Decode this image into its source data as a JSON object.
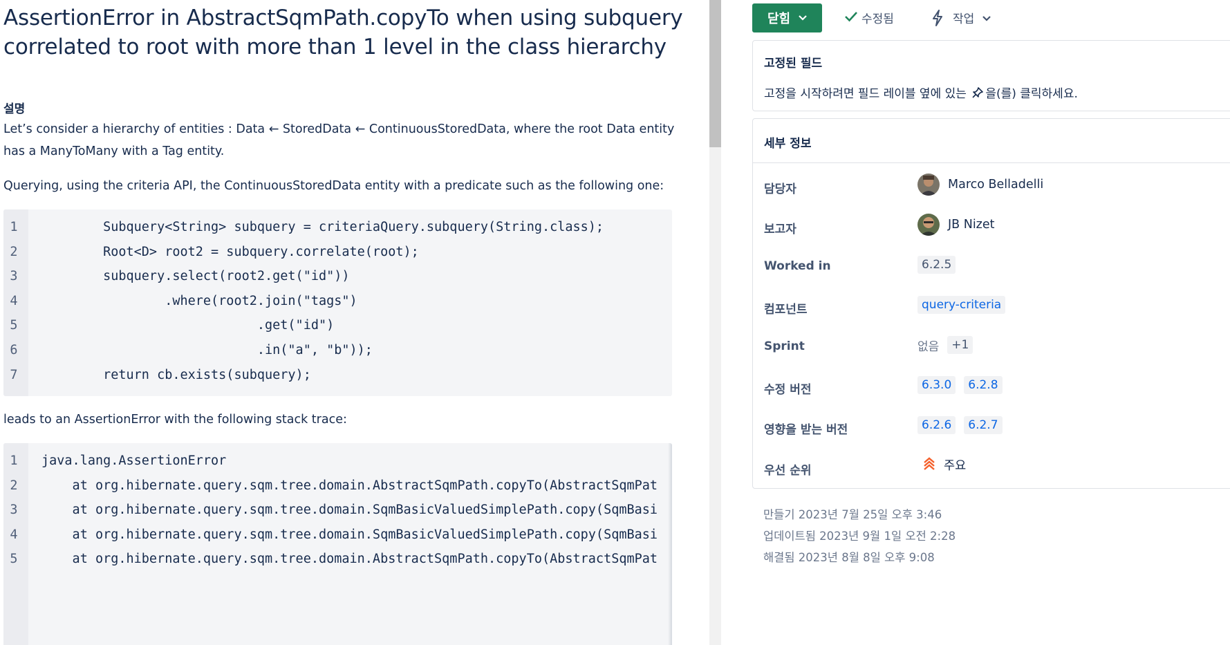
{
  "issue": {
    "title": "AssertionError in AbstractSqmPath.copyTo when using subquery correlated to root with more than 1 level in the class hierarchy",
    "description_heading": "설명",
    "paragraph1": "Let’s consider a hierarchy of entities : Data ← StoredData ← ContinuousStoredData, where the root Data entity has a ManyToMany with a Tag entity.",
    "paragraph2": "Querying, using the criteria API, the ContinuousStoredData entity with a predicate such as the following one:",
    "paragraph3": "leads to an AssertionError with the following stack trace:",
    "code1": [
      {
        "n": "1",
        "text": "        Subquery<String> subquery = criteriaQuery.subquery(String.class);"
      },
      {
        "n": "2",
        "text": "        Root<D> root2 = subquery.correlate(root);"
      },
      {
        "n": "3",
        "text": "        subquery.select(root2.get(\"id\"))"
      },
      {
        "n": "4",
        "text": "                .where(root2.join(\"tags\")"
      },
      {
        "n": "5",
        "text": "                            .get(\"id\")"
      },
      {
        "n": "6",
        "text": "                            .in(\"a\", \"b\"));"
      },
      {
        "n": "7",
        "text": "        return cb.exists(subquery);"
      }
    ],
    "code2": [
      {
        "n": "1",
        "text": "java.lang.AssertionError"
      },
      {
        "n": "2",
        "text": "    at org.hibernate.query.sqm.tree.domain.AbstractSqmPath.copyTo(AbstractSqmPat"
      },
      {
        "n": "3",
        "text": "    at org.hibernate.query.sqm.tree.domain.SqmBasicValuedSimplePath.copy(SqmBasi"
      },
      {
        "n": "4",
        "text": "    at org.hibernate.query.sqm.tree.domain.SqmBasicValuedSimplePath.copy(SqmBasi"
      },
      {
        "n": "5",
        "text": "    at org.hibernate.query.sqm.tree.domain.AbstractSqmPath.copyTo(AbstractSqmPat"
      }
    ]
  },
  "header": {
    "status_label": "닫힘",
    "resolution_label": "수정됨",
    "actions_label": "작업"
  },
  "pinned": {
    "title": "고정된 필드",
    "hint_before": "고정을 시작하려면 필드 레이블 옆에 있는",
    "hint_after": "을(를) 클릭하세요."
  },
  "details": {
    "title": "세부 정보",
    "assignee_label": "담당자",
    "assignee": "Marco Belladelli",
    "reporter_label": "보고자",
    "reporter": "JB Nizet",
    "worked_in_label": "Worked in",
    "worked_in": "6.2.5",
    "component_label": "컴포넌트",
    "component": "query-criteria",
    "sprint_label": "Sprint",
    "sprint_none": "없음",
    "sprint_more": "+1",
    "fix_version_label": "수정 버전",
    "fix_versions": [
      "6.3.0",
      "6.2.8"
    ],
    "affected_label": "영향을 받는 버전",
    "affected_versions": [
      "6.2.6",
      "6.2.7"
    ],
    "priority_label": "우선 순위",
    "priority": "주요"
  },
  "dates": {
    "created": "만들기 2023년 7월 25일 오후 3:46",
    "updated": "업데이트됨 2023년 9월 1일 오전 2:28",
    "resolved": "해결됨 2023년 8월 8일 오후 9:08"
  },
  "colors": {
    "status_green": "#1f845a",
    "link_blue": "#0c66e4",
    "priority_orange": "#f5602b"
  }
}
